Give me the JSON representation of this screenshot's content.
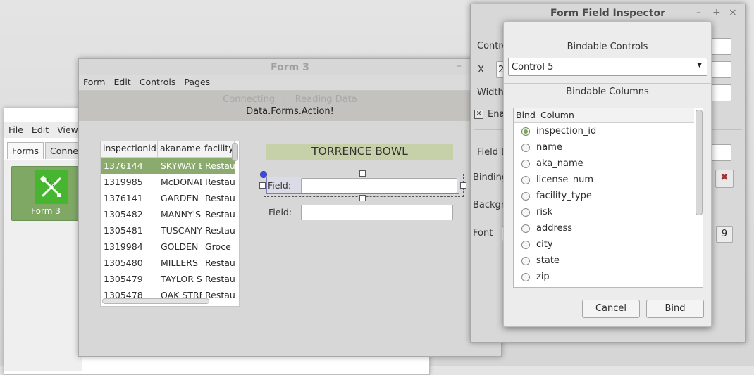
{
  "main_window": {
    "menu": [
      "File",
      "Edit",
      "View"
    ],
    "tabs": [
      {
        "label": "Forms",
        "active": true
      },
      {
        "label": "Connect",
        "active": false
      }
    ],
    "form_tile_label": "Form 3"
  },
  "form3_window": {
    "title": "Form 3",
    "minimize": "–",
    "menu": [
      "Form",
      "Edit",
      "Controls",
      "Pages"
    ],
    "status": {
      "steps": [
        "Connecting",
        "|",
        "Reading Data"
      ],
      "action": "Data.Forms.Action!"
    },
    "table": {
      "columns": [
        "inspectionid",
        "akaname",
        "facility"
      ],
      "rows": [
        [
          "1376144",
          "SKYWAY B",
          "Restau"
        ],
        [
          "1319985",
          "McDONAL",
          "Restau"
        ],
        [
          "1376141",
          "GARDEN I",
          "Restau"
        ],
        [
          "1305482",
          "MANNY'S",
          "Restau"
        ],
        [
          "1305481",
          "TUSCANY",
          "Restau"
        ],
        [
          "1319984",
          "GOLDEN F",
          "Groce"
        ],
        [
          "1305480",
          "MILLERS I",
          "Restau"
        ],
        [
          "1305479",
          "TAYLOR S",
          "Restau"
        ],
        [
          "1305478",
          "OAK STRE",
          "Restau"
        ]
      ],
      "selected_row": 0
    },
    "canvas": {
      "label_text": "TORRENCE BOWL",
      "field1_label": "Field:",
      "field2_label": "Field:"
    }
  },
  "inspector": {
    "title": "Form Field Inspector",
    "buttons": {
      "minimize": "–",
      "maximize": "+",
      "close": "×"
    },
    "labels": {
      "controls": "Contro",
      "x": "X",
      "width": "Width",
      "enabled": "Ena",
      "field_label": "Field L",
      "binding": "Binding",
      "background": "Backgr",
      "font": "Font"
    },
    "x_value": "2",
    "font_size": "9",
    "binding_clear_icon": "✖",
    "enabled_check_glyph": "✕"
  },
  "bind_dialog": {
    "controls_title": "Bindable Controls",
    "selected_control": "Control 5",
    "columns_title": "Bindable Columns",
    "list_headers": {
      "bind": "Bind",
      "column": "Column"
    },
    "columns": [
      {
        "name": "inspection_id",
        "selected": true
      },
      {
        "name": "name",
        "selected": false
      },
      {
        "name": "aka_name",
        "selected": false
      },
      {
        "name": "license_num",
        "selected": false
      },
      {
        "name": "facility_type",
        "selected": false
      },
      {
        "name": "risk",
        "selected": false
      },
      {
        "name": "address",
        "selected": false
      },
      {
        "name": "city",
        "selected": false
      },
      {
        "name": "state",
        "selected": false
      },
      {
        "name": "zip",
        "selected": false
      }
    ],
    "cancel_label": "Cancel",
    "bind_label": "Bind"
  },
  "colors": {
    "selection_green": "#8bab6e",
    "label_bar": "#c6d1a9",
    "tile_green": "#7fa865",
    "icon_green": "#46b530",
    "handle_blue": "#3d4ae0"
  }
}
